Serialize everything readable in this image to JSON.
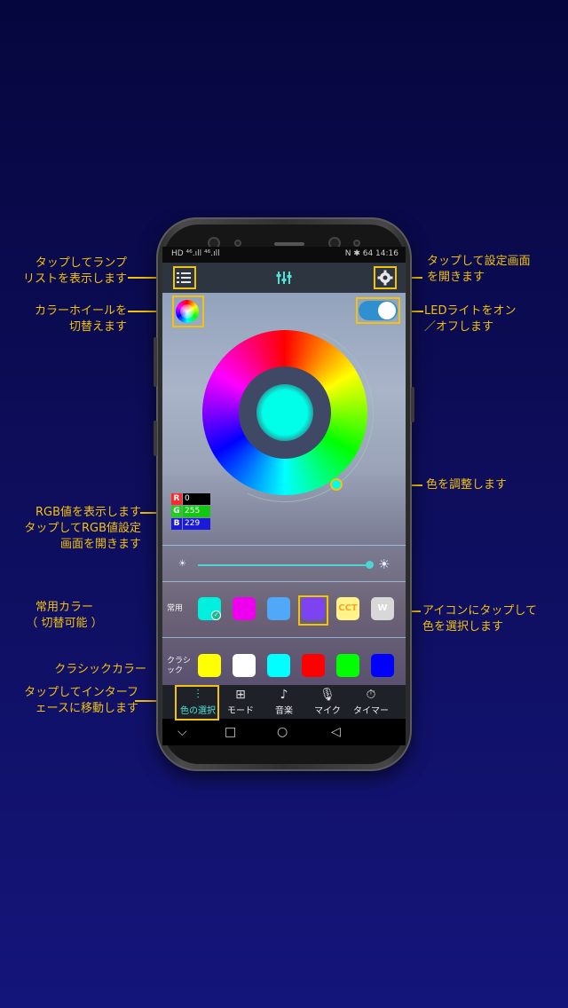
{
  "annotations": {
    "lamp_list": "タップしてランプ\nリストを表示します",
    "color_wheel_switch": "カラーホイールを\n切替えます",
    "rgb_value": "RGB値を表示します\nタップしてRGB値設定\n画面を開きます",
    "common_colors": "常用カラー\n（ 切替可能 ）",
    "classic_colors": "クラシックカラー",
    "tab_move": "タップしてインターフ\nェースに移動します",
    "settings": "タップして設定画面\nを開きます",
    "led_toggle": "LEDライトをオン\n／オフします",
    "adjust_color": "色を調整します",
    "icon_select": "アイコンにタップして\n色を選択します"
  },
  "status_bar": {
    "left": "HD ⁴⁶.ıll ⁴⁶.ıll",
    "right": "N ✱ 64 14:16"
  },
  "app_bar": {
    "menu_icon": "list-icon",
    "title_icon": "equalizer-icon",
    "settings_icon": "gear-icon"
  },
  "power_toggle": {
    "state": "on"
  },
  "rgb": {
    "r_label": "R",
    "r_value": "0",
    "g_label": "G",
    "g_value": "255",
    "b_label": "B",
    "b_value": "229"
  },
  "current_color": "#00ffe5",
  "brightness": 1.0,
  "common_row": {
    "label": "常用",
    "swatches": [
      "#00f0e0",
      "#ee00ee",
      "#50a8f8",
      "#7b44f0",
      "#fff38a",
      "#d8d8d8"
    ],
    "cct_label": "CCT",
    "w_label": "W"
  },
  "classic_row": {
    "label": "クラシ\nック",
    "swatches": [
      "#ffff00",
      "#ffffff",
      "#00ffff",
      "#ff0000",
      "#00ff00",
      "#0000ff"
    ]
  },
  "tabs": [
    {
      "label": "色の選択",
      "icon": "equalizer-icon"
    },
    {
      "label": "モード",
      "icon": "grid-icon"
    },
    {
      "label": "音楽",
      "icon": "music-icon"
    },
    {
      "label": "マイク",
      "icon": "mic-icon"
    },
    {
      "label": "タイマー",
      "icon": "timer-icon"
    }
  ],
  "nav": {
    "down": "⌵",
    "square": "□",
    "circle": "○",
    "back": "◁"
  },
  "accent_color": "#f2c20c"
}
